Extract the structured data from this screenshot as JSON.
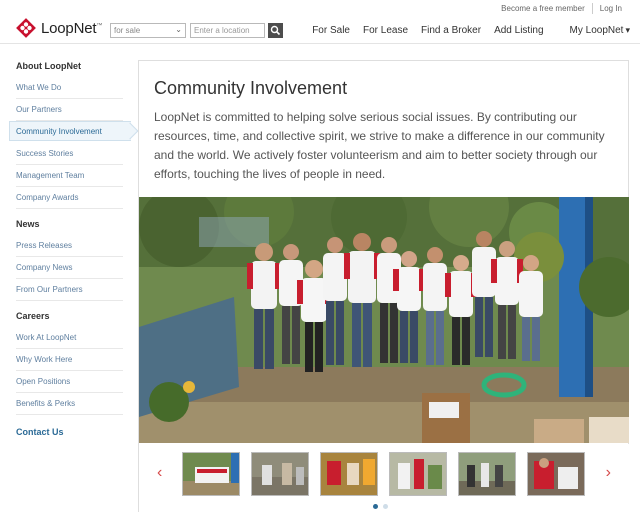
{
  "brand": {
    "name": "LoopNet",
    "trademark": "™",
    "accent": "#c8102e"
  },
  "header": {
    "search_type_value": "for sale",
    "location_placeholder": "Enter a location",
    "top_links": [
      "Become a free member",
      "Log In"
    ],
    "nav": [
      "For Sale",
      "For Lease",
      "Find a Broker",
      "Add Listing",
      "My LoopNet"
    ]
  },
  "sidebar": {
    "about": {
      "heading": "About LoopNet",
      "items": [
        "What We Do",
        "Our Partners",
        "Community Involvement",
        "Success Stories",
        "Management Team",
        "Company Awards"
      ],
      "active": "Community Involvement"
    },
    "news": {
      "heading": "News",
      "items": [
        "Press Releases",
        "Company News",
        "From Our Partners"
      ]
    },
    "careers": {
      "heading": "Careers",
      "items": [
        "Work At LoopNet",
        "Why Work Here",
        "Open Positions",
        "Benefits & Perks"
      ]
    },
    "contact": "Contact Us"
  },
  "main": {
    "title": "Community Involvement",
    "description": "LoopNet is committed to helping solve serious social issues. By contributing our resources, time, and collective spirit, we strive to make a difference in our community and the world. We actively foster volunteerism and aim to better society through our efforts, touching the lives of people in need."
  },
  "gallery": {
    "thumb_count": 6,
    "dots_count": 2,
    "active_dot": 0,
    "dot_active_color": "#2b6a96",
    "dot_inactive_color": "#cfdde8"
  }
}
